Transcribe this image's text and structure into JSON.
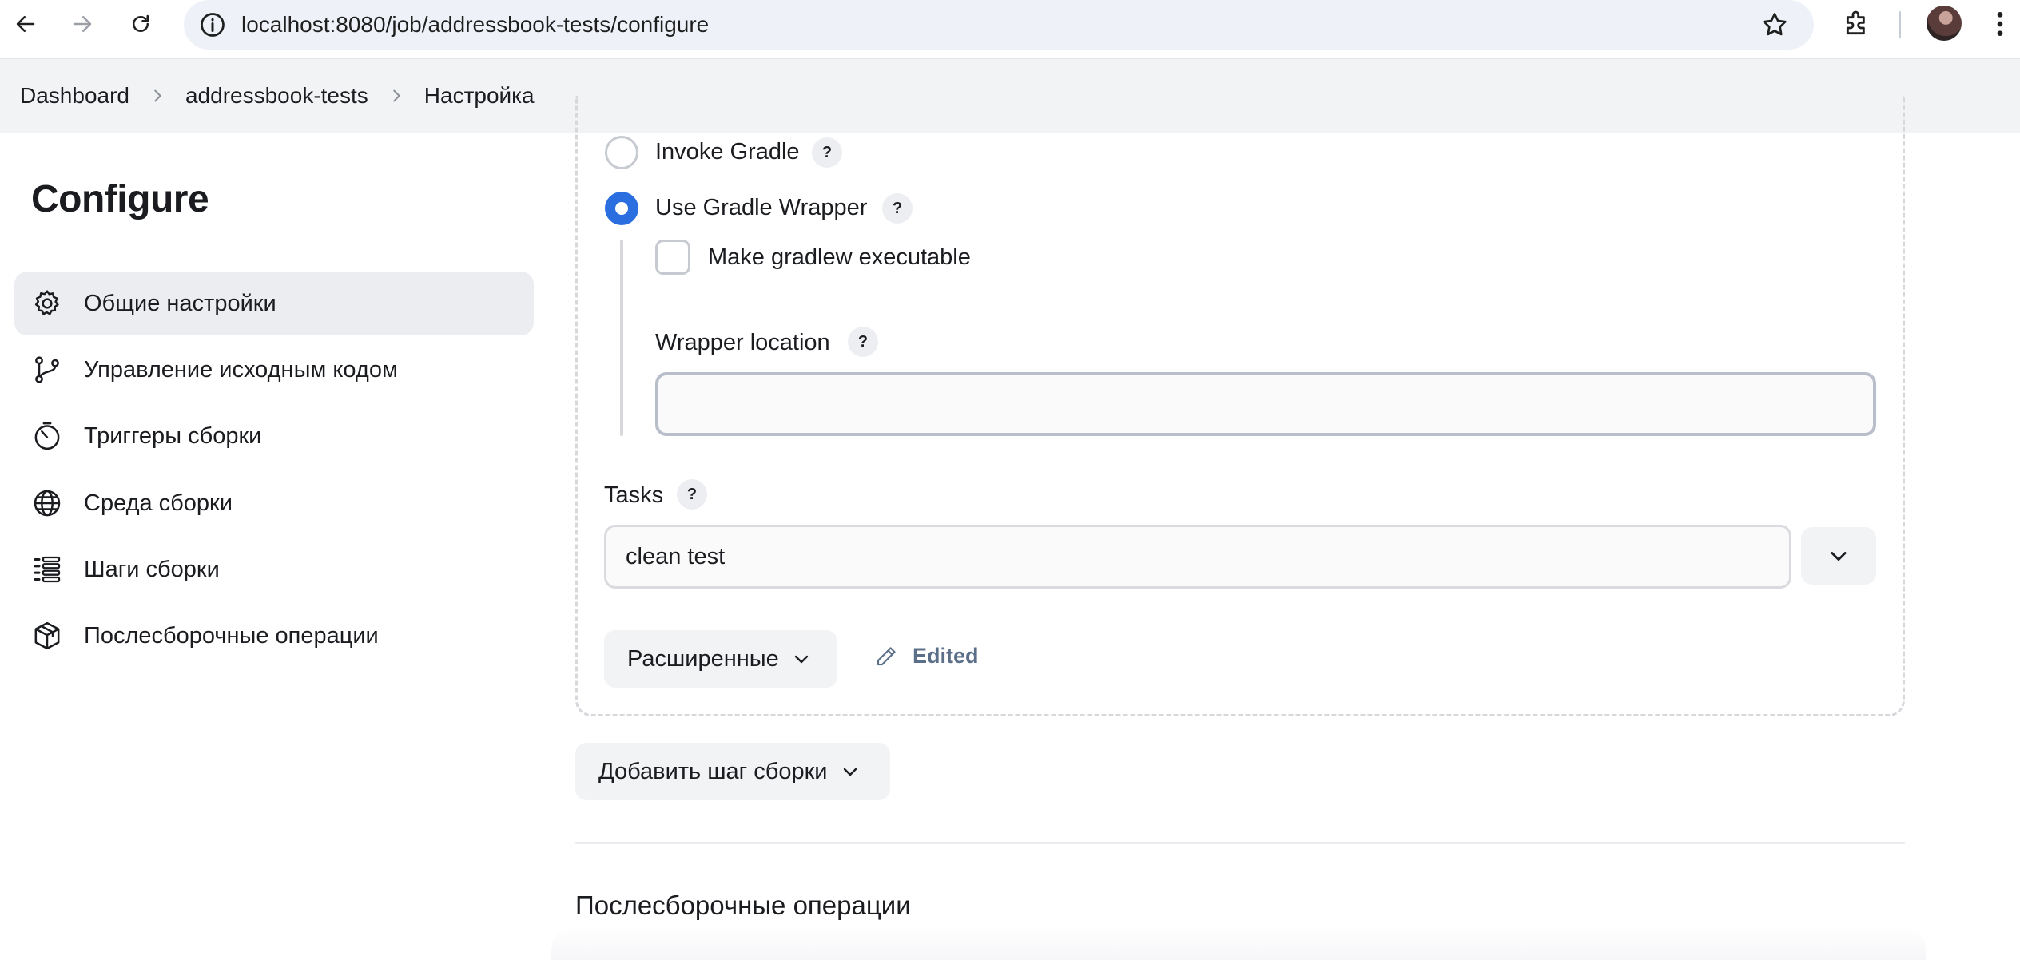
{
  "browser": {
    "url": "localhost:8080/job/addressbook-tests/configure"
  },
  "breadcrumb": {
    "items": [
      "Dashboard",
      "addressbook-tests",
      "Настройка"
    ]
  },
  "sidebar": {
    "title": "Configure",
    "items": [
      {
        "label": "Общие настройки",
        "icon": "gear-icon",
        "active": true
      },
      {
        "label": "Управление исходным кодом",
        "icon": "git-branch-icon",
        "active": false
      },
      {
        "label": "Триггеры сборки",
        "icon": "timer-icon",
        "active": false
      },
      {
        "label": "Среда сборки",
        "icon": "globe-icon",
        "active": false
      },
      {
        "label": "Шаги сборки",
        "icon": "list-icon",
        "active": false
      },
      {
        "label": "Послесборочные операции",
        "icon": "package-icon",
        "active": false
      }
    ]
  },
  "build_step": {
    "invoke_gradle_label": "Invoke Gradle",
    "use_wrapper_label": "Use Gradle Wrapper",
    "selected": "Use Gradle Wrapper",
    "make_executable_label": "Make gradlew executable",
    "make_executable_checked": false,
    "wrapper_location_label": "Wrapper location",
    "wrapper_location_value": "",
    "tasks_label": "Tasks",
    "tasks_value": "clean test",
    "advanced_label": "Расширенные",
    "edited_label": "Edited",
    "help_symbol": "?"
  },
  "add_build_step_label": "Добавить шаг сборки",
  "post_build_title": "Послесборочные операции",
  "colors": {
    "accent": "#2a6ee0",
    "edited": "#5b7088",
    "active_bg": "#ebedf1"
  }
}
